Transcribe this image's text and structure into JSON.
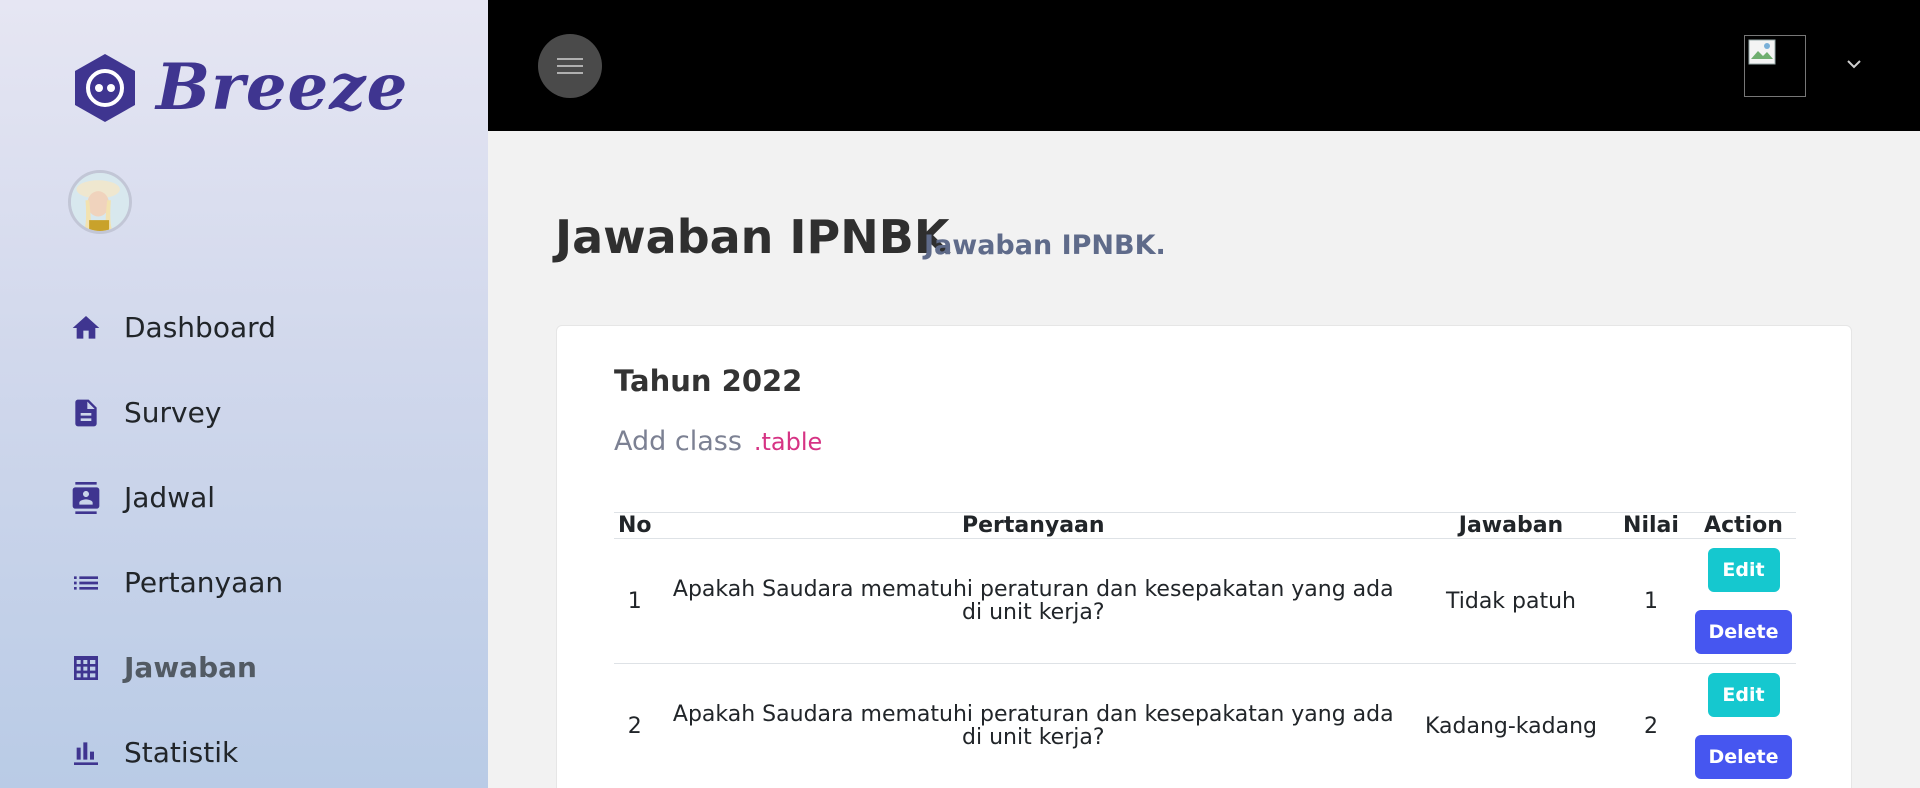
{
  "sidebar": {
    "brand": "Breeze",
    "items": [
      {
        "label": "Dashboard",
        "icon": "home-icon"
      },
      {
        "label": "Survey",
        "icon": "file-text-icon"
      },
      {
        "label": "Jadwal",
        "icon": "contact-book-icon"
      },
      {
        "label": "Pertanyaan",
        "icon": "list-icon"
      },
      {
        "label": "Jawaban",
        "icon": "table-grid-icon",
        "active": true
      },
      {
        "label": "Statistik",
        "icon": "bar-chart-icon"
      }
    ]
  },
  "topbar": {
    "menu_icon": "menu-icon",
    "user_caret": "chevron-down-icon"
  },
  "main": {
    "title": "Jawaban IPNBK",
    "subtitle": "Jawaban IPNBK.",
    "card": {
      "title": "Tahun 2022",
      "desc": "Add class",
      "desc_code": ".table",
      "columns": [
        "No",
        "Pertanyaan",
        "Jawaban",
        "Nilai",
        "Action"
      ],
      "rows": [
        {
          "no": "1",
          "pertanyaan": "Apakah Saudara mematuhi peraturan dan kesepakatan yang ada di unit kerja?",
          "jawaban": "Tidak patuh",
          "nilai": "1",
          "edit": "Edit",
          "delete": "Delete"
        },
        {
          "no": "2",
          "pertanyaan": "Apakah Saudara mematuhi peraturan dan kesepakatan yang ada di unit kerja?",
          "jawaban": "Kadang-kadang",
          "nilai": "2",
          "edit": "Edit",
          "delete": "Delete"
        }
      ]
    }
  },
  "colors": {
    "brand": "#3f3590",
    "edit": "#15c8cf",
    "delete": "#4656f0",
    "code": "#d63384"
  }
}
